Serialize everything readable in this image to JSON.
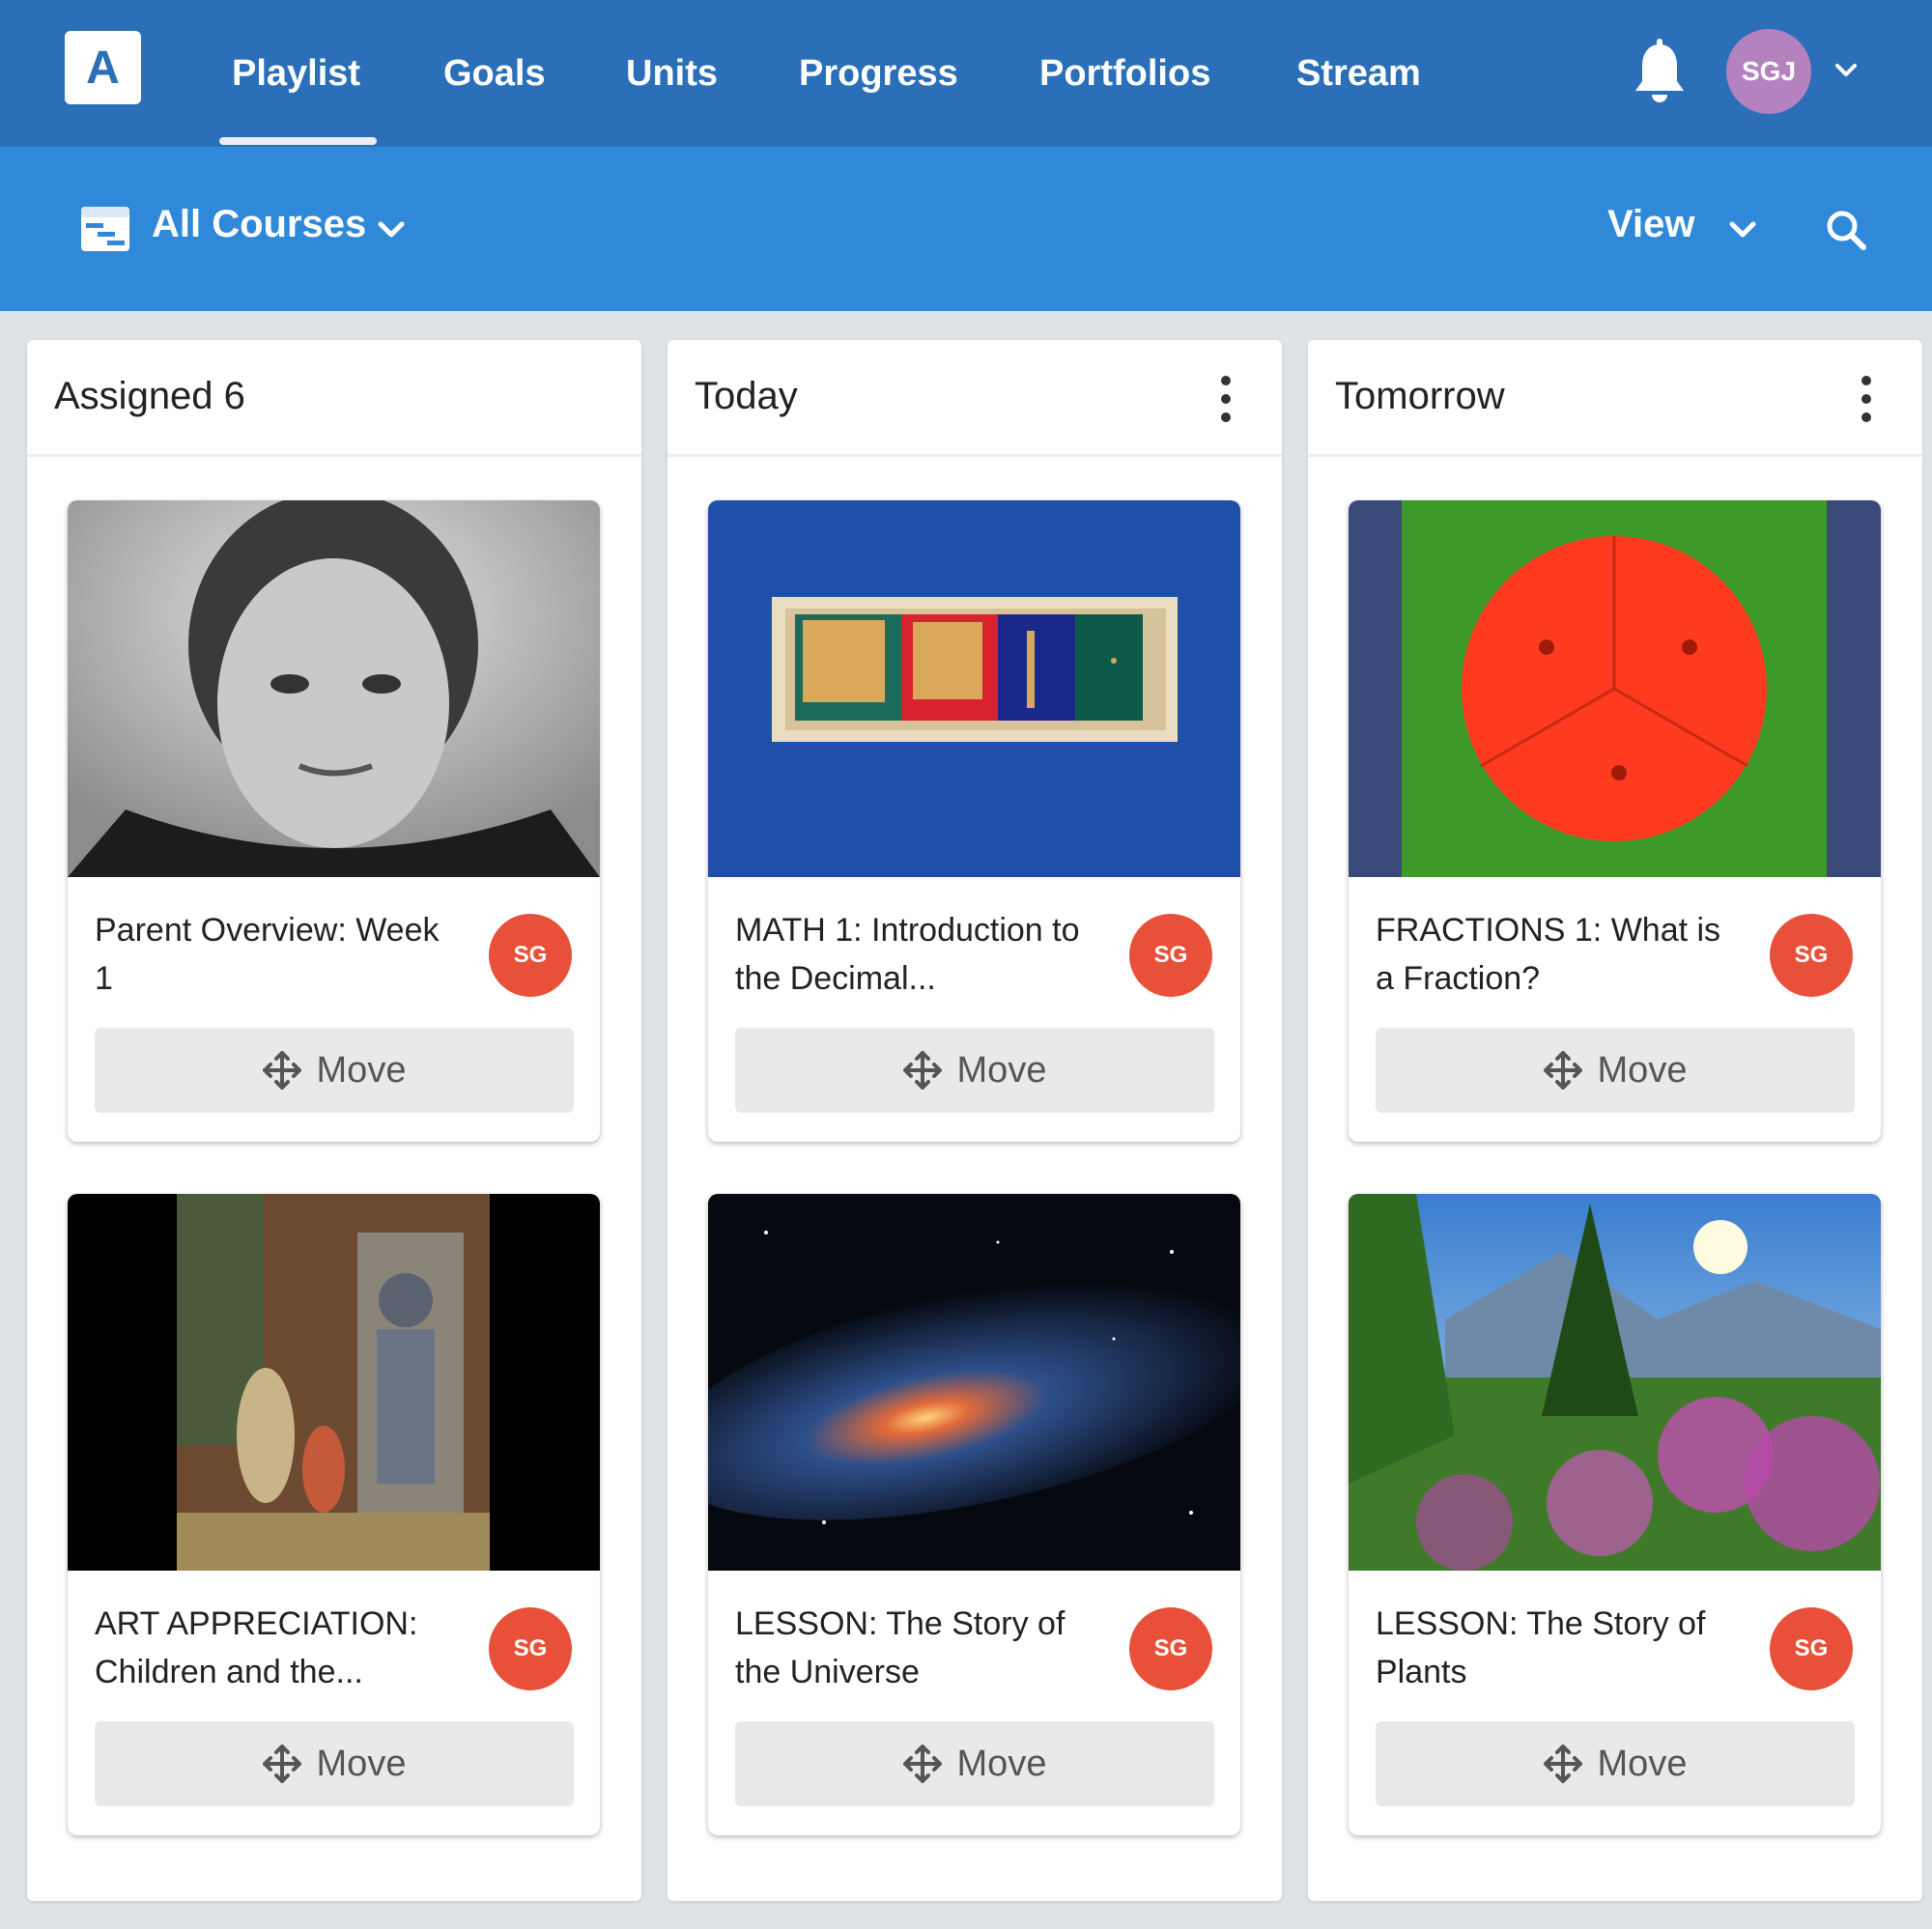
{
  "app": {
    "logo_letter": "A"
  },
  "nav": {
    "tabs": [
      {
        "label": "Playlist",
        "active": true
      },
      {
        "label": "Goals"
      },
      {
        "label": "Units"
      },
      {
        "label": "Progress"
      },
      {
        "label": "Portfolios"
      },
      {
        "label": "Stream"
      }
    ],
    "user_initials": "SGJ",
    "avatar_color": "#b482bf"
  },
  "toolbar": {
    "course_filter": "All Courses",
    "view_label": "View"
  },
  "columns": [
    {
      "title": "Assigned 6",
      "has_menu": false,
      "cards": [
        {
          "title": "Parent Overview: Week 1",
          "badge": "SG",
          "move_label": "Move",
          "image": "black-and-white-portrait"
        },
        {
          "title": "ART APPRECIATION: Children and the...",
          "badge": "SG",
          "move_label": "Move",
          "image": "painting-children-armor"
        }
      ]
    },
    {
      "title": "Today",
      "has_menu": true,
      "cards": [
        {
          "title": "MATH 1: Introduction to the Decimal...",
          "badge": "SG",
          "move_label": "Move",
          "image": "decimal-bead-tray"
        },
        {
          "title": "LESSON: The Story of the Universe",
          "badge": "SG",
          "move_label": "Move",
          "image": "galaxy"
        }
      ]
    },
    {
      "title": "Tomorrow",
      "has_menu": true,
      "cards": [
        {
          "title": "FRACTIONS 1: What is a Fraction?",
          "badge": "SG",
          "move_label": "Move",
          "image": "fraction-circle"
        },
        {
          "title": "LESSON: The Story of Plants",
          "badge": "SG",
          "move_label": "Move",
          "image": "mountain-flowers"
        }
      ]
    }
  ],
  "colors": {
    "topbar": "#2a6fb8",
    "subbar": "#2f89d8",
    "badge": "#e8503a"
  }
}
